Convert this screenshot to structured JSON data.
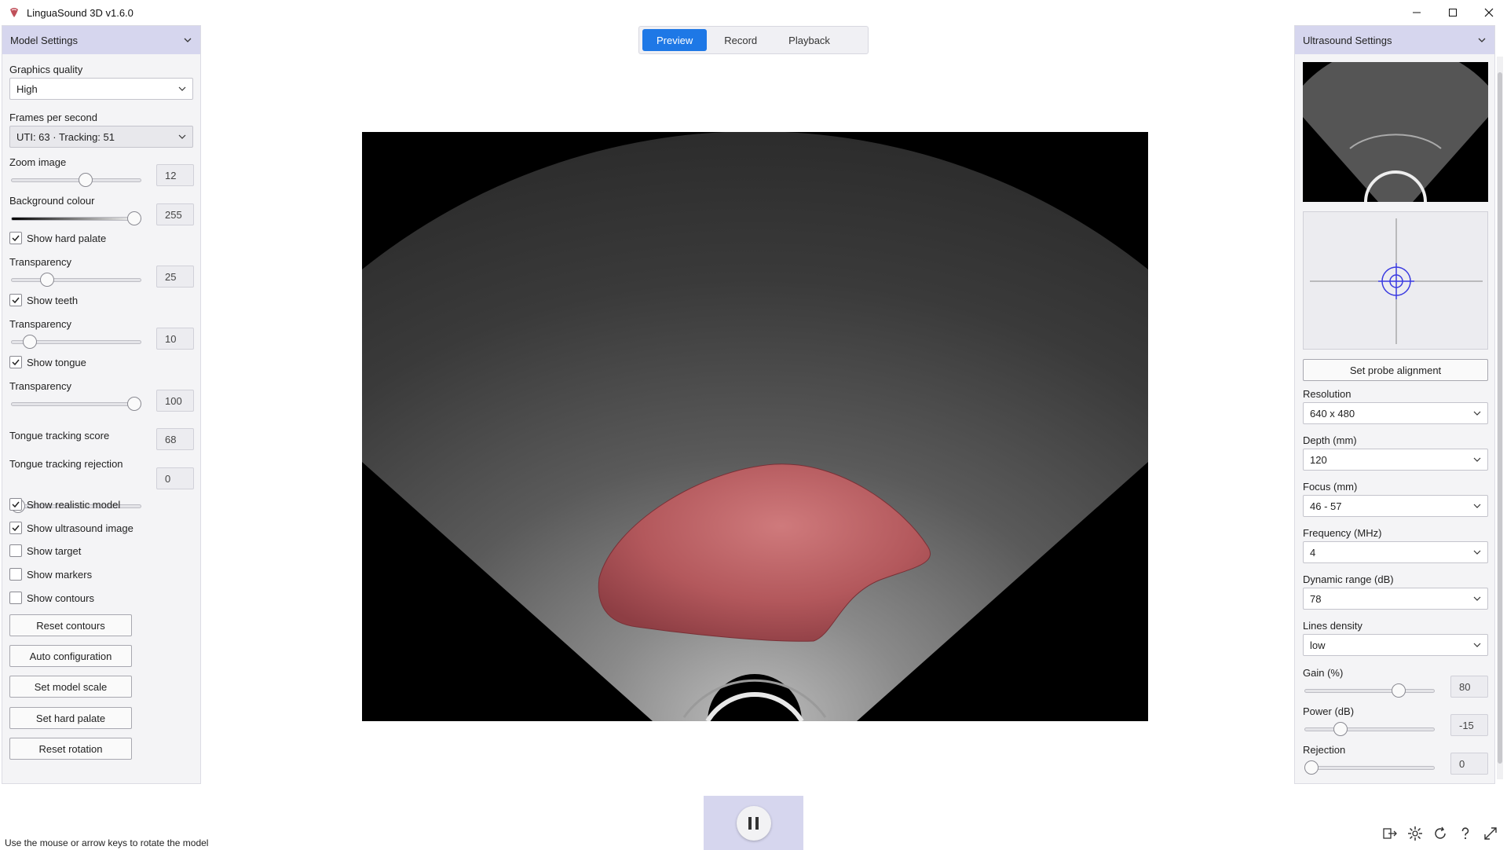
{
  "window": {
    "title": "LinguaSound 3D v1.6.0",
    "minimize": "—",
    "maximize": "☐",
    "close": "✕"
  },
  "tabs": [
    {
      "label": "Preview",
      "active": true
    },
    {
      "label": "Record",
      "active": false
    },
    {
      "label": "Playback",
      "active": false
    }
  ],
  "model_settings": {
    "header": "Model Settings",
    "graphics_quality": {
      "label": "Graphics quality",
      "value": "High"
    },
    "fps": {
      "label": "Frames per second",
      "value": "UTI: 63 · Tracking: 51"
    },
    "zoom": {
      "label": "Zoom image",
      "value": "12",
      "fraction": 0.58
    },
    "background": {
      "label": "Background colour",
      "value": "255",
      "fraction": 1.0
    },
    "hard_palate": {
      "label": "Show hard palate",
      "checked": true
    },
    "hard_palate_transparency": {
      "label": "Transparency",
      "value": "25",
      "fraction": 0.25
    },
    "teeth": {
      "label": "Show teeth",
      "checked": true
    },
    "teeth_transparency": {
      "label": "Transparency",
      "value": "10",
      "fraction": 0.1
    },
    "tongue": {
      "label": "Show tongue",
      "checked": true
    },
    "tongue_transparency": {
      "label": "Transparency",
      "value": "100",
      "fraction": 1.0
    },
    "tracking_score": {
      "label": "Tongue tracking score",
      "value": "68"
    },
    "tracking_rejection": {
      "label": "Tongue tracking rejection",
      "value": "0",
      "fraction": 0.0
    },
    "realistic_model": {
      "label": "Show realistic model",
      "checked": true
    },
    "ultrasound_image": {
      "label": "Show ultrasound image",
      "checked": true
    },
    "target": {
      "label": "Show target",
      "checked": false
    },
    "markers": {
      "label": "Show markers",
      "checked": false
    },
    "contours": {
      "label": "Show contours",
      "checked": false
    },
    "buttons": {
      "reset_contours": "Reset contours",
      "auto_configuration": "Auto configuration",
      "set_model_scale": "Set model scale",
      "set_hard_palate": "Set hard palate",
      "reset_rotation": "Reset rotation"
    }
  },
  "ultrasound_settings": {
    "header": "Ultrasound Settings",
    "set_probe_alignment": "Set probe alignment",
    "resolution": {
      "label": "Resolution",
      "value": "640 x 480"
    },
    "depth": {
      "label": "Depth (mm)",
      "value": "120"
    },
    "focus": {
      "label": "Focus (mm)",
      "value": "46 - 57"
    },
    "frequency": {
      "label": "Frequency (MHz)",
      "value": "4"
    },
    "dynamic_range": {
      "label": "Dynamic range (dB)",
      "value": "78"
    },
    "lines_density": {
      "label": "Lines density",
      "value": "low"
    },
    "gain": {
      "label": "Gain (%)",
      "value": "80",
      "fraction": 0.75
    },
    "power": {
      "label": "Power (dB)",
      "value": "-15",
      "fraction": 0.25
    },
    "rejection": {
      "label": "Rejection",
      "value": "0",
      "fraction": 0.0
    }
  },
  "status_text": "Use the mouse or arrow keys to rotate the model",
  "colors": {
    "accent": "#1e78e6",
    "panel_header": "#d6d6ee",
    "tongue": "#b85a5e"
  }
}
